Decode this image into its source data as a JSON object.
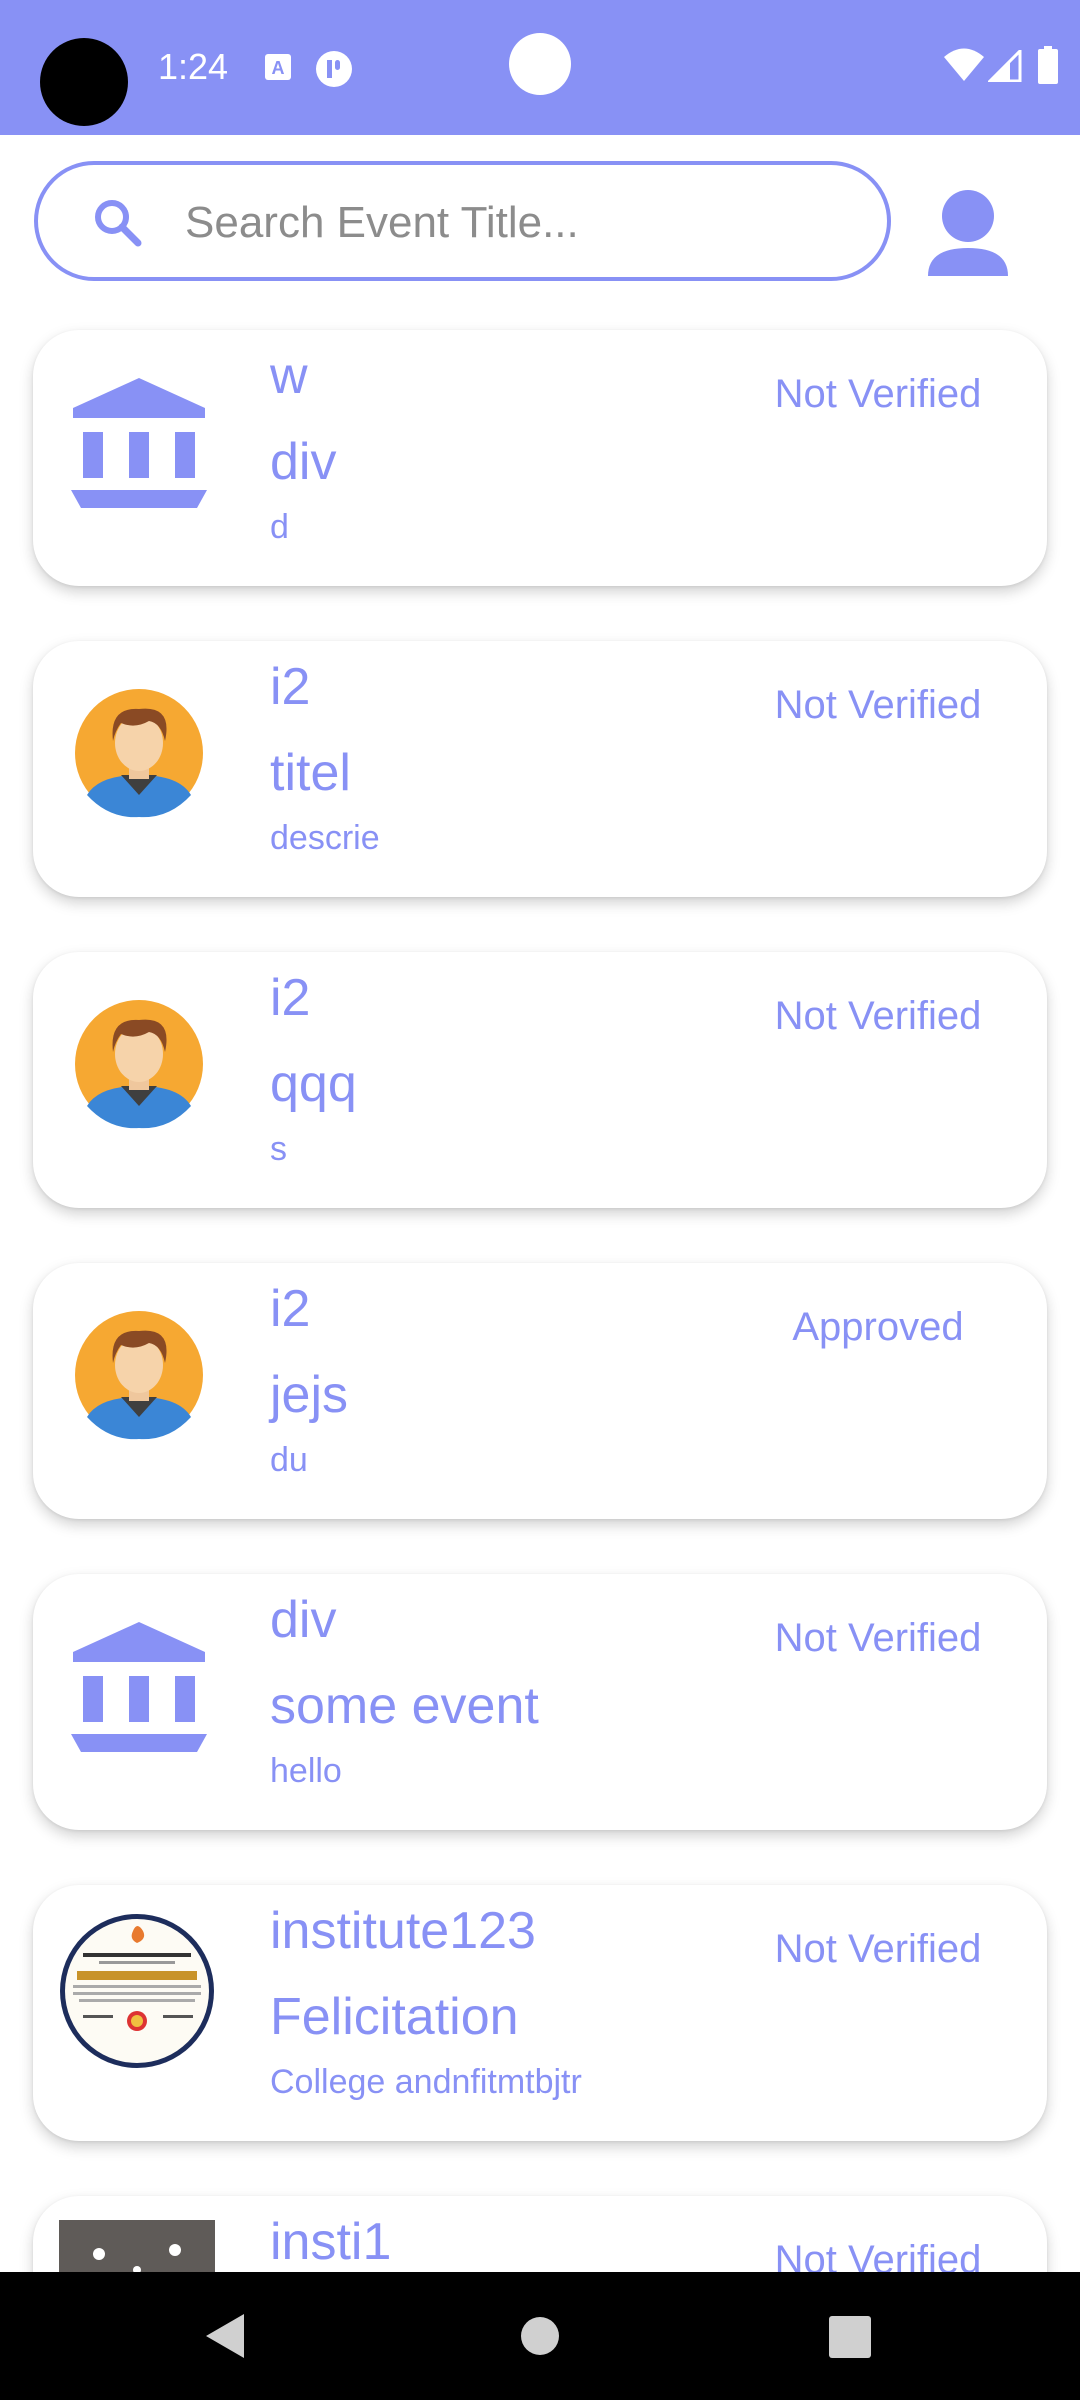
{
  "status_bar": {
    "time": "1:24",
    "left_icons": [
      "text-a-icon",
      "app-indicator-icon"
    ],
    "right_icons": [
      "wifi-icon",
      "signal-icon",
      "battery-icon"
    ]
  },
  "search": {
    "placeholder": "Search Event Title..."
  },
  "events": [
    {
      "org": "w",
      "title": "div",
      "description": "d",
      "status": "Not Verified",
      "avatar": "institution-icon"
    },
    {
      "org": "i2",
      "title": "titel",
      "description": "descrie",
      "status": "Not Verified",
      "avatar": "person-avatar"
    },
    {
      "org": "i2",
      "title": "qqq",
      "description": "s",
      "status": "Not Verified",
      "avatar": "person-avatar"
    },
    {
      "org": "i2",
      "title": "jejs",
      "description": "du",
      "status": "Approved",
      "avatar": "person-avatar"
    },
    {
      "org": "div",
      "title": "some event",
      "description": "hello",
      "status": "Not Verified",
      "avatar": "institution-icon"
    },
    {
      "org": "institute123",
      "title": "Felicitation",
      "description": "College andnfitmtbjtr",
      "status": "Not Verified",
      "avatar": "certificate-image"
    },
    {
      "org": "insti1",
      "title": "",
      "description": "",
      "status": "Not Verified",
      "avatar": "room-photo"
    }
  ],
  "colors": {
    "accent": "#8891f5",
    "avatar_bg": "#f6a832"
  }
}
